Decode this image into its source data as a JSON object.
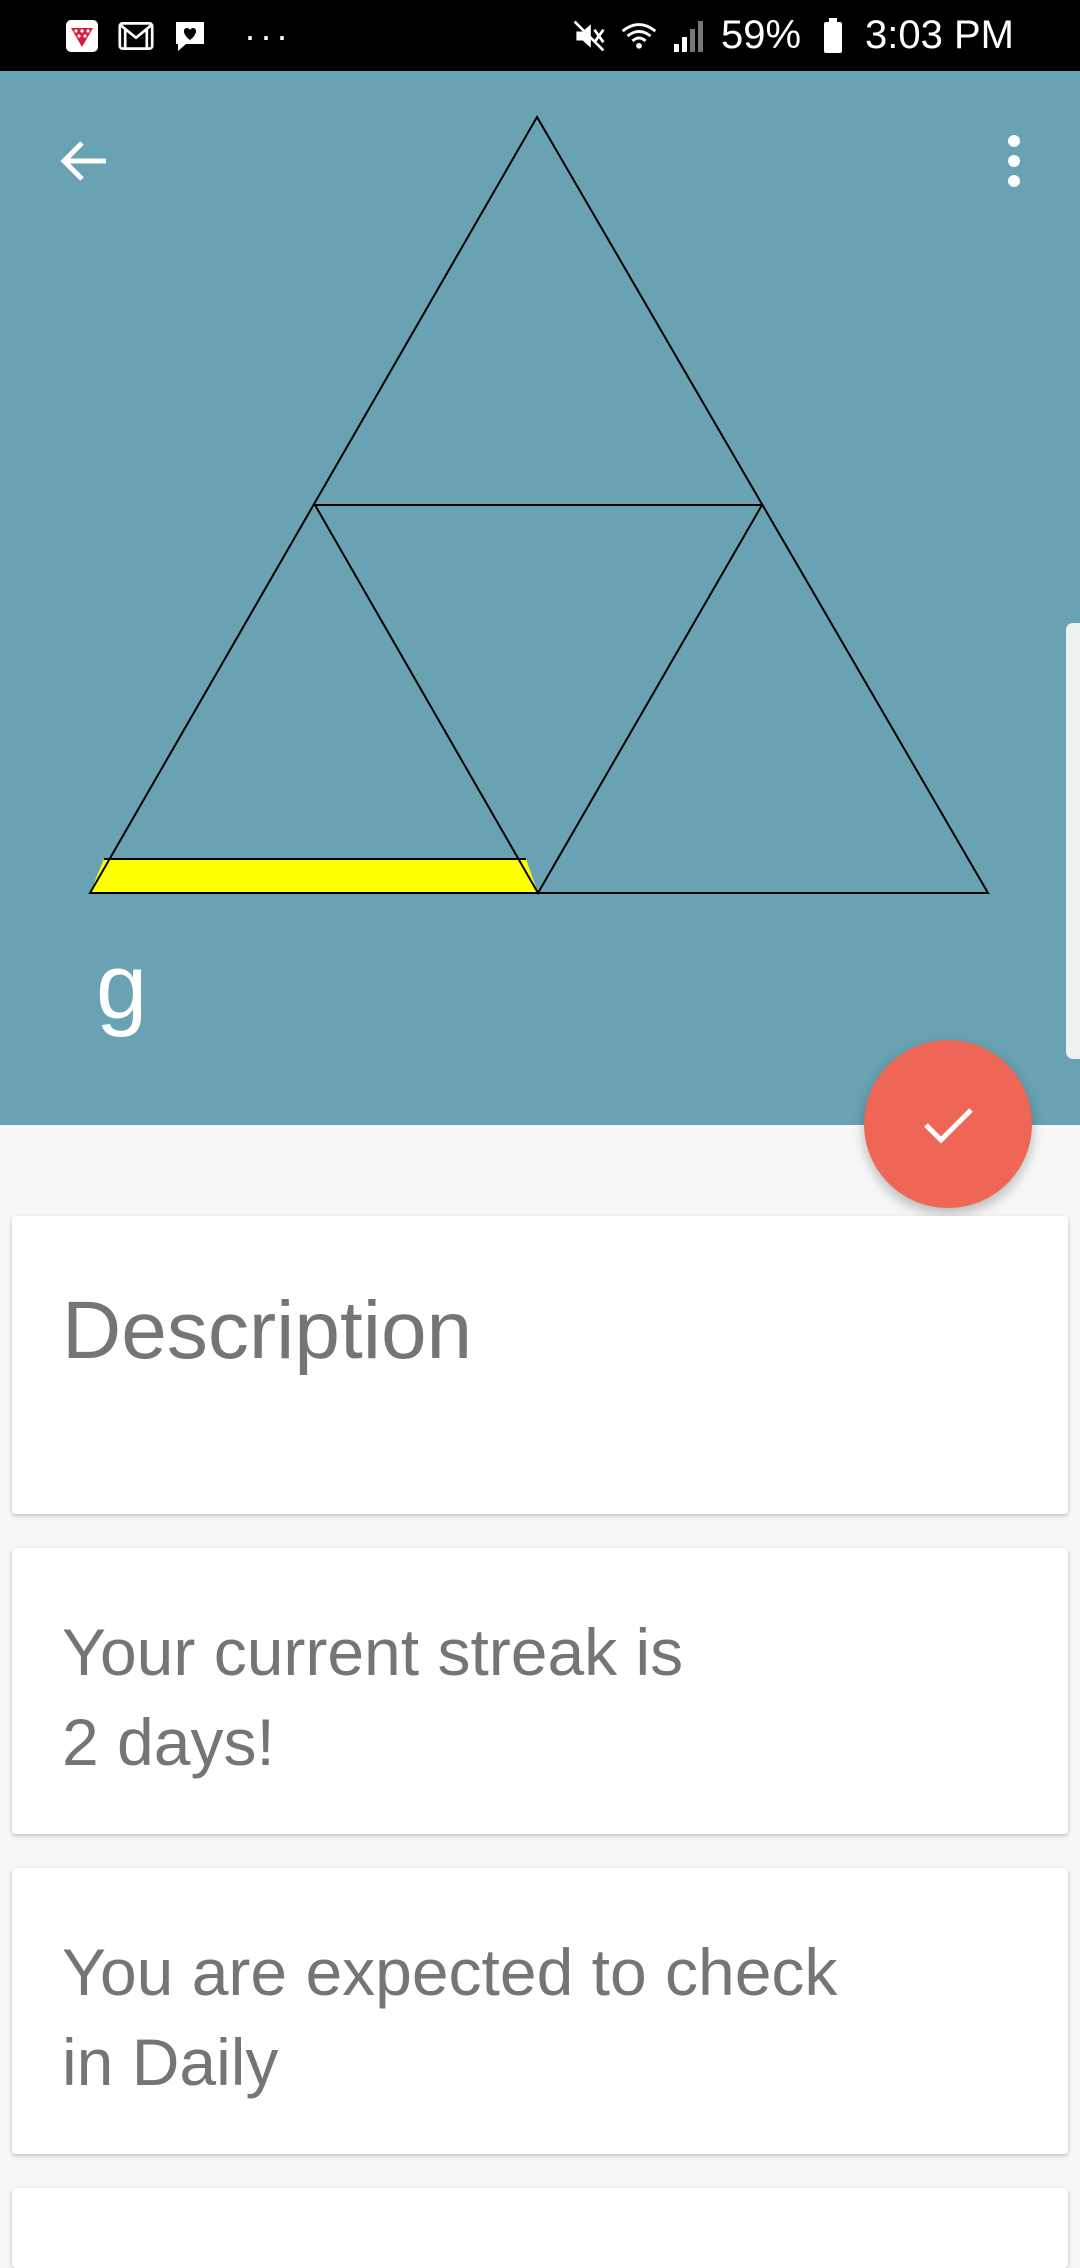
{
  "status_bar": {
    "battery_text": "59%",
    "time": "3:03 PM",
    "overflow_dots": "···",
    "icons": [
      "app-notification-icon",
      "gmail-icon",
      "messages-icon",
      "mute-icon",
      "wifi-icon",
      "signal-icon",
      "battery-icon"
    ]
  },
  "header": {
    "habit_name": "g",
    "background_color": "#69a2b2",
    "progress_highlight_color": "#ffff00",
    "icons": [
      "arrow-back-icon",
      "more-vert-icon"
    ]
  },
  "fab": {
    "icon": "check-icon",
    "color": "#ee6656"
  },
  "cards": {
    "description_placeholder": "Description",
    "streak_line1": "Your current streak is",
    "streak_line2": "2 days!",
    "expected_line1": "You are expected to check",
    "expected_line2": "in Daily"
  }
}
